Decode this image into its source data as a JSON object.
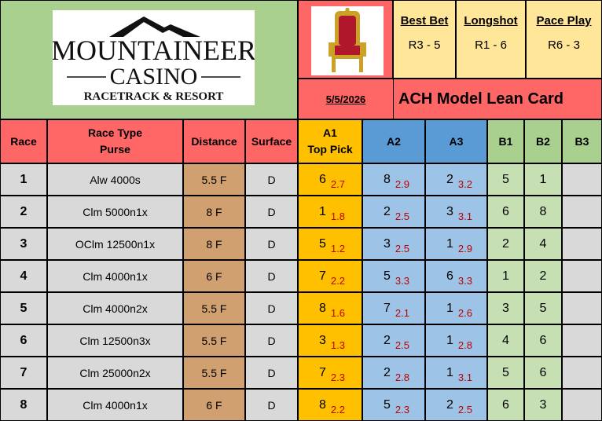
{
  "logo": {
    "line1": "MOUNTAINEER",
    "line2": "CASINO",
    "line3": "RACETRACK & RESORT"
  },
  "bets": [
    {
      "label": "Best Bet",
      "value": "R3 - 5"
    },
    {
      "label": "Longshot",
      "value": "R1 - 6"
    },
    {
      "label": "Pace Play",
      "value": "R6 - 3"
    }
  ],
  "date": "5/5/2026",
  "title": "ACH Model Lean Card",
  "headers": {
    "race": "Race",
    "race_type_1": "Race Type",
    "race_type_2": "Purse",
    "distance": "Distance",
    "surface": "Surface",
    "a1_1": "A1",
    "a1_2": "Top Pick",
    "a2": "A2",
    "a3": "A3",
    "b1": "B1",
    "b2": "B2",
    "b3": "B3"
  },
  "colors": {
    "red": "#ff6666",
    "green": "#a9d08e",
    "yellow": "#ffe699",
    "grey": "#d9d9d9",
    "tan": "#d0a070",
    "orange": "#ffc000",
    "blue": "#9dc3e6",
    "blue_hdr": "#5b9bd5",
    "lightgreen": "#c6e0b4",
    "odds": "#c00000"
  },
  "rows": [
    {
      "race": "1",
      "type": "Alw 4000s",
      "distance": "5.5 F",
      "surface": "D",
      "a1": "6",
      "a1_odds": "2.7",
      "a2": "8",
      "a2_odds": "2.9",
      "a3": "2",
      "a3_odds": "3.2",
      "b1": "5",
      "b2": "1",
      "b3": ""
    },
    {
      "race": "2",
      "type": "Clm 5000n1x",
      "distance": "8 F",
      "surface": "D",
      "a1": "1",
      "a1_odds": "1.8",
      "a2": "2",
      "a2_odds": "2.5",
      "a3": "3",
      "a3_odds": "3.1",
      "b1": "6",
      "b2": "8",
      "b3": ""
    },
    {
      "race": "3",
      "type": "OClm 12500n1x",
      "distance": "8 F",
      "surface": "D",
      "a1": "5",
      "a1_odds": "1.2",
      "a2": "3",
      "a2_odds": "2.5",
      "a3": "1",
      "a3_odds": "2.9",
      "b1": "2",
      "b2": "4",
      "b3": ""
    },
    {
      "race": "4",
      "type": "Clm 4000n1x",
      "distance": "6 F",
      "surface": "D",
      "a1": "7",
      "a1_odds": "2.2",
      "a2": "5",
      "a2_odds": "3.3",
      "a3": "6",
      "a3_odds": "3.3",
      "b1": "1",
      "b2": "2",
      "b3": ""
    },
    {
      "race": "5",
      "type": "Clm 4000n2x",
      "distance": "5.5 F",
      "surface": "D",
      "a1": "8",
      "a1_odds": "1.6",
      "a2": "7",
      "a2_odds": "2.1",
      "a3": "1",
      "a3_odds": "2.6",
      "b1": "3",
      "b2": "5",
      "b3": ""
    },
    {
      "race": "6",
      "type": "Clm 12500n3x",
      "distance": "5.5 F",
      "surface": "D",
      "a1": "3",
      "a1_odds": "1.3",
      "a2": "2",
      "a2_odds": "2.5",
      "a3": "1",
      "a3_odds": "2.8",
      "b1": "4",
      "b2": "6",
      "b3": ""
    },
    {
      "race": "7",
      "type": "Clm 25000n2x",
      "distance": "5.5 F",
      "surface": "D",
      "a1": "7",
      "a1_odds": "2.3",
      "a2": "2",
      "a2_odds": "2.8",
      "a3": "1",
      "a3_odds": "3.1",
      "b1": "5",
      "b2": "6",
      "b3": ""
    },
    {
      "race": "8",
      "type": "Clm 4000n1x",
      "distance": "6 F",
      "surface": "D",
      "a1": "8",
      "a1_odds": "2.2",
      "a2": "5",
      "a2_odds": "2.3",
      "a3": "2",
      "a3_odds": "2.5",
      "b1": "6",
      "b2": "3",
      "b3": ""
    }
  ]
}
